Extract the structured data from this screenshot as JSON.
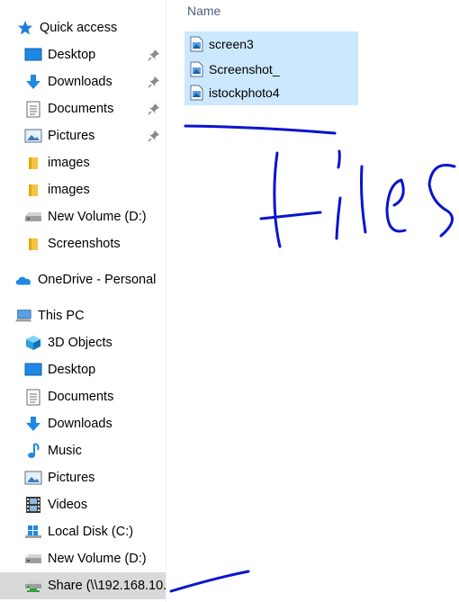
{
  "navigation": {
    "quick_access": {
      "label": "Quick access"
    },
    "quick_items": [
      {
        "label": "Desktop",
        "icon": "desktop-icon",
        "pinned": true
      },
      {
        "label": "Downloads",
        "icon": "download-arrow-icon",
        "pinned": true
      },
      {
        "label": "Documents",
        "icon": "documents-icon",
        "pinned": true
      },
      {
        "label": "Pictures",
        "icon": "pictures-icon",
        "pinned": true
      },
      {
        "label": "images",
        "icon": "folder-icon",
        "pinned": false
      },
      {
        "label": "images",
        "icon": "folder-icon",
        "pinned": false
      },
      {
        "label": "New Volume (D:)",
        "icon": "drive-icon",
        "pinned": false
      },
      {
        "label": "Screenshots",
        "icon": "folder-icon",
        "pinned": false
      }
    ],
    "onedrive": {
      "label": "OneDrive - Personal"
    },
    "this_pc": {
      "label": "This PC"
    },
    "pc_items": [
      {
        "label": "3D Objects",
        "icon": "3d-objects-icon"
      },
      {
        "label": "Desktop",
        "icon": "desktop-icon"
      },
      {
        "label": "Documents",
        "icon": "documents-icon"
      },
      {
        "label": "Downloads",
        "icon": "download-arrow-icon"
      },
      {
        "label": "Music",
        "icon": "music-note-icon"
      },
      {
        "label": "Pictures",
        "icon": "pictures-icon"
      },
      {
        "label": "Videos",
        "icon": "video-film-icon"
      },
      {
        "label": "Local Disk (C:)",
        "icon": "windows-drive-icon"
      },
      {
        "label": "New Volume (D:)",
        "icon": "drive-icon"
      },
      {
        "label": "Share (\\\\192.168.10.",
        "icon": "network-drive-icon",
        "selected": true
      }
    ]
  },
  "content": {
    "column_header": "Name",
    "files": [
      {
        "name": "screen3",
        "icon": "image-file-icon"
      },
      {
        "name": "Screenshot_",
        "icon": "image-file-icon"
      },
      {
        "name": "istockphoto4",
        "icon": "image-file-icon"
      }
    ]
  },
  "colors": {
    "selection": "#cce8ff",
    "nav_selected": "#d9d9d9",
    "ink": "#0a14d0",
    "header_text": "#4c607a"
  }
}
